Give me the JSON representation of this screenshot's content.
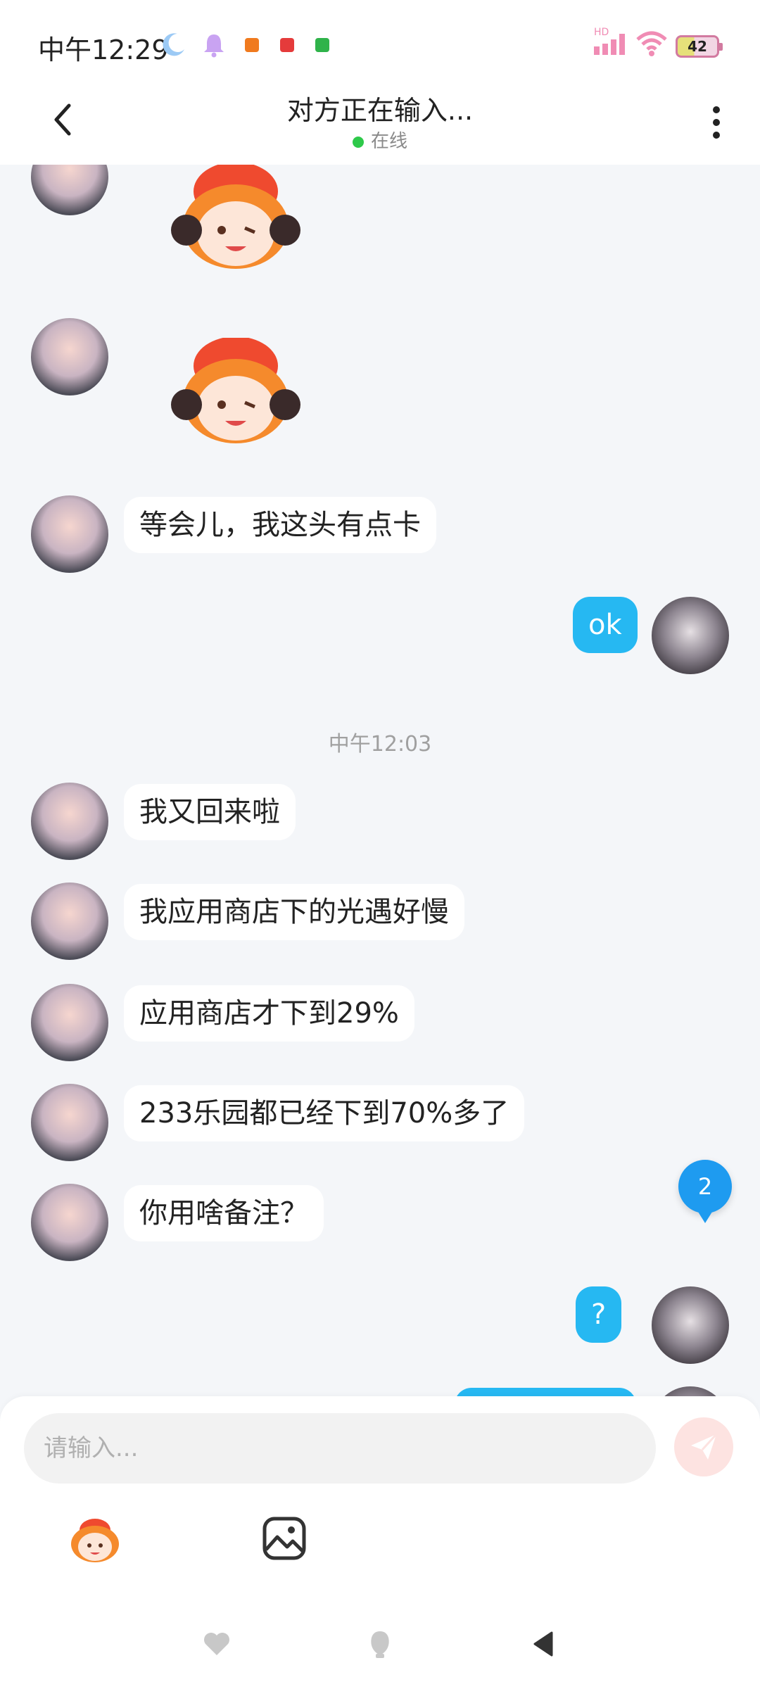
{
  "status_bar": {
    "time": "中午12:29",
    "battery": "42",
    "network": "HD"
  },
  "header": {
    "title": "对方正在输入...",
    "status": "在线"
  },
  "messages": [
    {
      "type": "sticker",
      "from": "in"
    },
    {
      "type": "sticker",
      "from": "in"
    },
    {
      "type": "text",
      "from": "in",
      "text": "等会儿，我这头有点卡"
    },
    {
      "type": "text",
      "from": "out",
      "text": "ok"
    },
    {
      "type": "time",
      "text": "中午12:03"
    },
    {
      "type": "text",
      "from": "in",
      "text": "我又回来啦"
    },
    {
      "type": "text",
      "from": "in",
      "text": "我应用商店下的光遇好慢"
    },
    {
      "type": "text",
      "from": "in",
      "text": "应用商店才下到29%"
    },
    {
      "type": "text",
      "from": "in",
      "text": "233乐园都已经下到70%多了"
    },
    {
      "type": "text",
      "from": "in",
      "text": "你用啥备注？"
    },
    {
      "type": "text",
      "from": "out",
      "text": "?"
    },
    {
      "type": "text",
      "from": "out",
      "text": ""
    }
  ],
  "unread_count": "2",
  "composer": {
    "placeholder": "请输入..."
  },
  "colors": {
    "outgoing_bubble": "#26b8f2",
    "online": "#2ec94a",
    "unread_badge": "#1e9bf0",
    "send_button": "#fde3e1"
  },
  "icons": {
    "back": "chevron-left-icon",
    "more": "more-vertical-icon",
    "send": "send-icon",
    "emoji": "sticker-face-icon",
    "image": "image-icon"
  }
}
